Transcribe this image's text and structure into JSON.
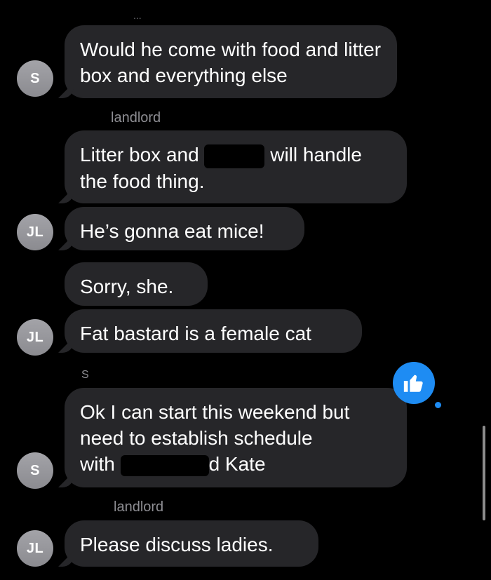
{
  "conversation": {
    "messages": [
      {
        "avatar": "S",
        "sender": "",
        "text": "Would he come with food and litter box and everything else"
      },
      {
        "avatar": "",
        "sender": "landlord",
        "text_before": "Litter box and",
        "text_after": "will handle the food thing."
      },
      {
        "avatar": "JL",
        "sender": "",
        "text": "He’s gonna eat mice!"
      },
      {
        "avatar": "",
        "sender": "",
        "text": "Sorry, she."
      },
      {
        "avatar": "JL",
        "sender": "",
        "text": "Fat bastard is a female cat"
      },
      {
        "avatar": "S",
        "sender": "S",
        "text_line1": "Ok I can start this weekend but",
        "text_line2": "need to establish  schedule",
        "text_line3_before": "with",
        "text_line3_after": "d Kate"
      },
      {
        "avatar": "JL",
        "sender": "landlord",
        "text": "Please discuss ladies."
      }
    ],
    "reaction": {
      "type": "thumbs-up",
      "color": "#1e8cf3"
    },
    "top_fragment": "...",
    "colors": {
      "background": "#000000",
      "bubble": "#262629",
      "avatar": "#98989d",
      "sender_label": "#8e8e93",
      "reaction": "#1e8cf3"
    }
  }
}
